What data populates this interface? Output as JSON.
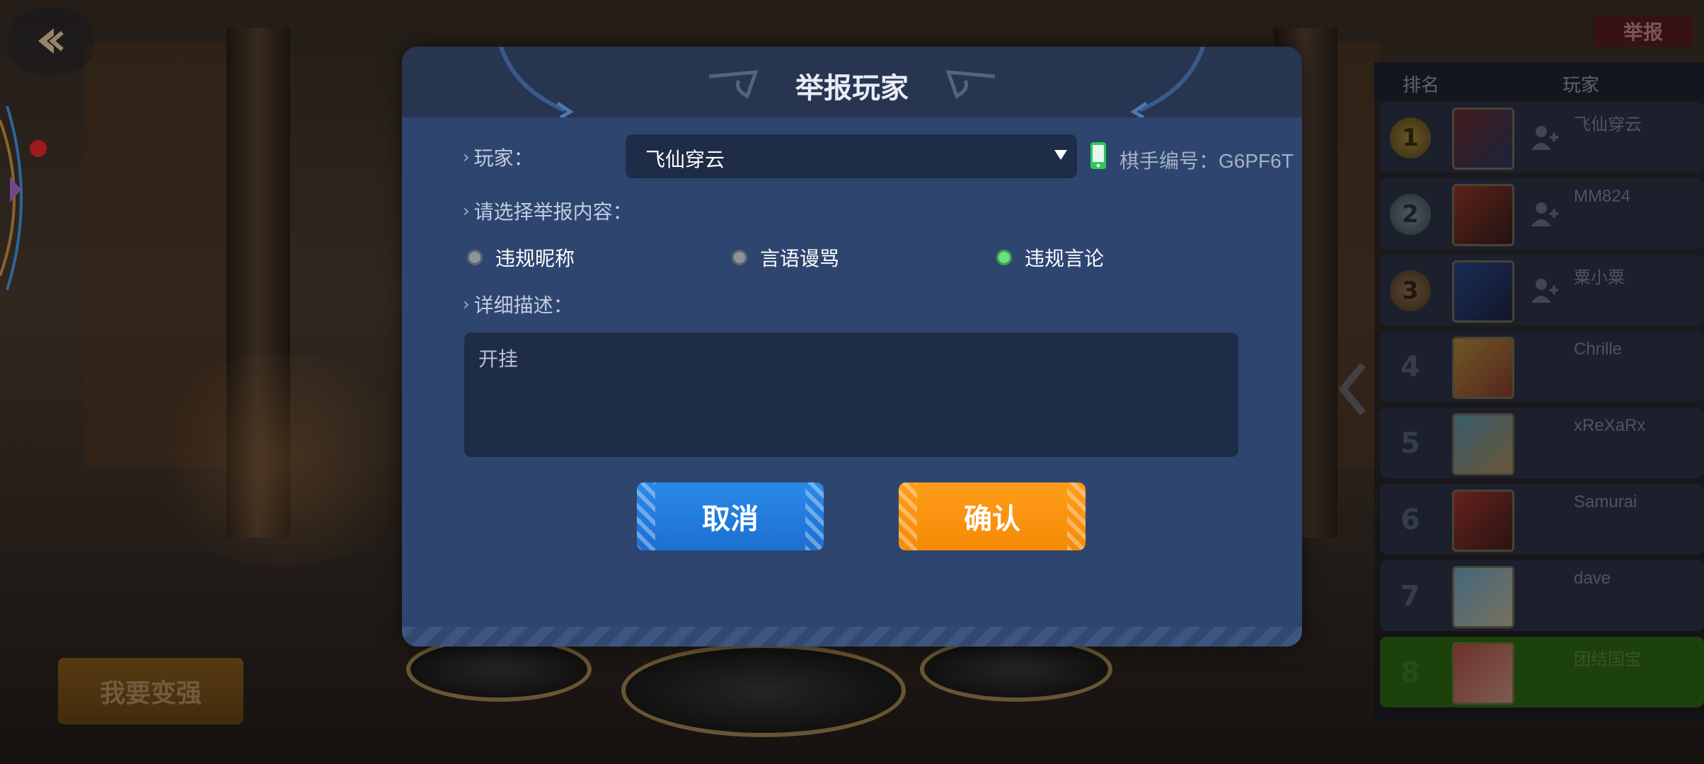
{
  "background": {
    "strong_button_label": "我要变强",
    "report_button_label": "举报"
  },
  "rank_panel": {
    "header_rank": "排名",
    "header_player": "玩家",
    "rows": [
      {
        "rank": "1",
        "name": "飞仙穿云",
        "medal": "gold",
        "has_add_friend": true
      },
      {
        "rank": "2",
        "name": "MM824",
        "medal": "silver",
        "has_add_friend": true
      },
      {
        "rank": "3",
        "name": "粟小粟",
        "medal": "bronze",
        "has_add_friend": true
      },
      {
        "rank": "4",
        "name": "Chrille"
      },
      {
        "rank": "5",
        "name": "xReXaRx"
      },
      {
        "rank": "6",
        "name": "Samurai"
      },
      {
        "rank": "7",
        "name": "dave"
      },
      {
        "rank": "8",
        "name": "团结国宝",
        "is_self": true
      }
    ]
  },
  "modal": {
    "title": "举报玩家",
    "player_label": "玩家：",
    "player_selected": "飞仙穿云",
    "player_id": "棋手编号：G6PF6T",
    "content_label": "请选择举报内容：",
    "options": [
      {
        "label": "违规昵称",
        "selected": false
      },
      {
        "label": "言语谩骂",
        "selected": false
      },
      {
        "label": "违规言论",
        "selected": true
      }
    ],
    "detail_label": "详细描述：",
    "detail_value": "开挂",
    "cancel_label": "取消",
    "confirm_label": "确认"
  },
  "colors": {
    "modal_bg": "#2e4570",
    "cancel": "#1c6fd0",
    "confirm": "#f58a05",
    "radio_selected": "#6be07c",
    "self_row": "#2f6a12"
  }
}
